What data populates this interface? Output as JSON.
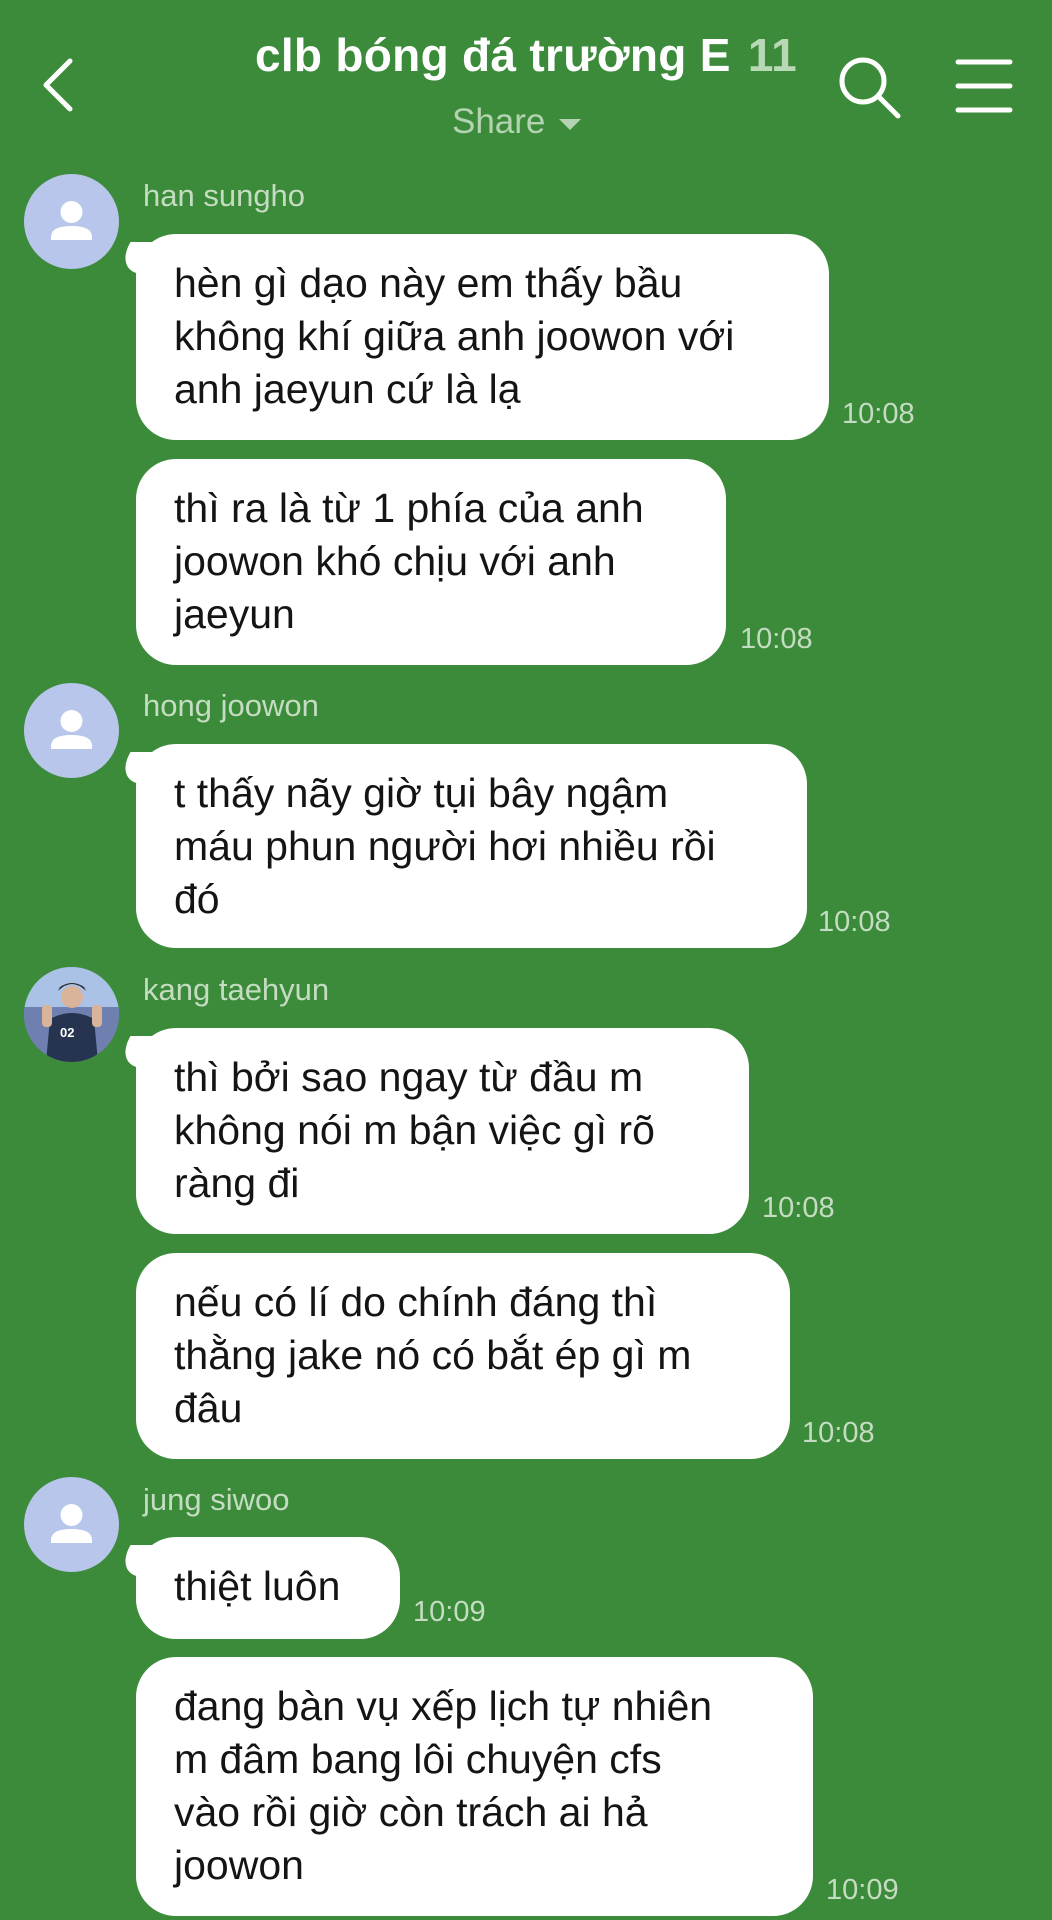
{
  "header": {
    "title": "clb bóng đá trường E",
    "member_count": "11",
    "subtitle": "Share",
    "icons": [
      "chevron-left-icon",
      "search-icon",
      "menu-icon"
    ]
  },
  "messages": [
    {
      "sender": "han sungho",
      "avatar": "default",
      "text": "hèn gì dạo này em thấy bầu\nkhông khí giữa anh joowon với\nanh jaeyun cứ là lạ",
      "time": "10:08"
    },
    {
      "sender": "",
      "text": "thì ra là từ 1 phía của anh\njoowon khó chịu với anh\njaeyun",
      "time": "10:08"
    },
    {
      "sender": "hong joowon",
      "avatar": "default",
      "text": "t thấy nãy giờ tụi bây ngậm\nmáu phun người hơi nhiều rồi\nđó",
      "time": "10:08"
    },
    {
      "sender": "kang taehyun",
      "avatar": "photo",
      "text": "thì bởi sao ngay từ đầu m\nkhông nói m bận việc gì rõ\nràng đi",
      "time": "10:08"
    },
    {
      "sender": "",
      "text": "nếu có lí do chính đáng thì\nthằng jake nó có bắt ép gì m\nđâu",
      "time": "10:08"
    },
    {
      "sender": "jung siwoo",
      "avatar": "default",
      "text": "thiệt luôn",
      "time": "10:09"
    },
    {
      "sender": "",
      "text": "đang bàn vụ xếp lịch tự nhiên\nm đâm bang lôi chuyện cfs\nvào rồi giờ còn trách ai hả\njoowon",
      "time": "10:09"
    }
  ],
  "colors": {
    "background": "#3c8b3a",
    "bubble": "#ffffff",
    "avatar_default": "#b7c6ea"
  }
}
